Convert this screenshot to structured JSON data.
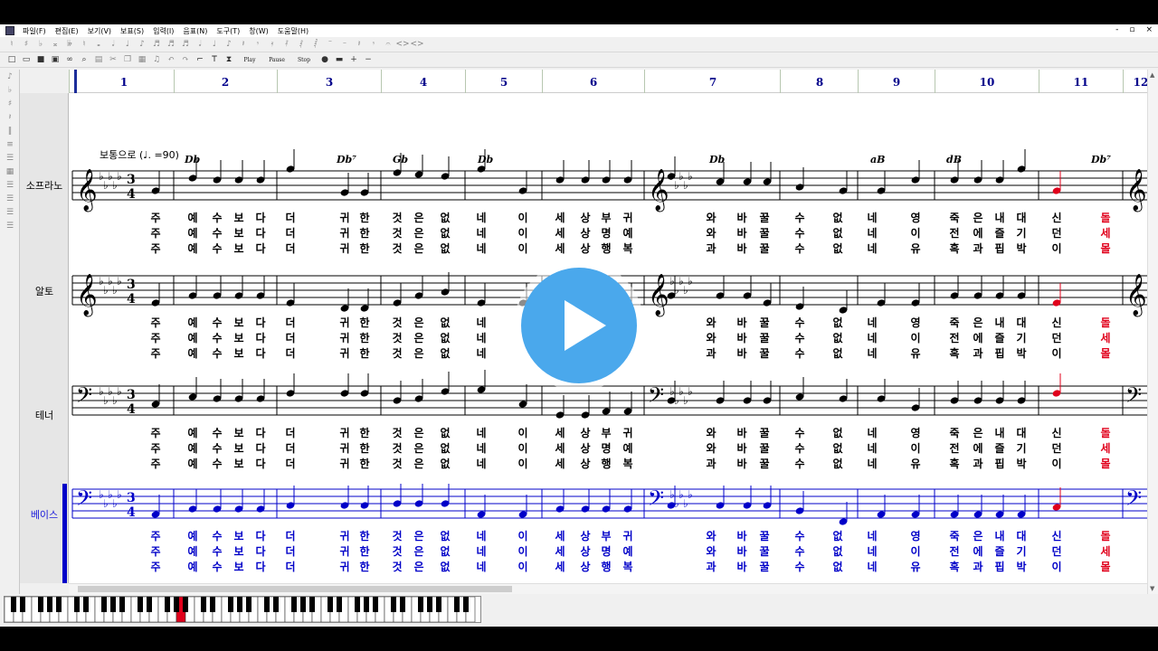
{
  "menu": [
    "파일(F)",
    "편집(E)",
    "보기(V)",
    "보표(S)",
    "입력(I)",
    "음표(N)",
    "도구(T)",
    "창(W)",
    "도움말(H)"
  ],
  "window_controls": [
    "-",
    "▫",
    "×"
  ],
  "toolbar1": [
    "♮",
    "♯",
    "♭",
    "𝄪",
    "𝄫",
    "♮",
    "𝅝",
    "𝅗𝅥",
    "♩",
    "♪",
    "♬",
    "♬",
    "♬",
    "𝅗𝅥",
    "♩",
    "♪",
    "𝄽",
    "𝄾",
    "𝄿",
    "𝅀",
    "𝅁",
    "𝅂",
    "𝄻",
    "𝄼",
    "𝄽",
    "𝄾",
    "𝄐",
    "<>",
    "<>"
  ],
  "toolbar2": {
    "icons": [
      "new-icon",
      "open-icon",
      "save-icon",
      "print-icon",
      "preview-icon",
      "zoom-icon",
      "page-icon",
      "cut-icon",
      "copy-icon",
      "paste-icon",
      "note-icon",
      "undo-icon",
      "redo-icon",
      "tie-icon",
      "text-icon",
      "metronome-icon"
    ],
    "play_label": "Play",
    "pause_label": "Pause",
    "stop_label": "Stop"
  },
  "ruler": {
    "measures": [
      "1",
      "2",
      "3",
      "4",
      "5",
      "6",
      "7",
      "8",
      "9",
      "10",
      "11",
      "12"
    ]
  },
  "score": {
    "tempo": "보통으로 (♩. =90)",
    "chords": [
      "Db",
      "Db⁷",
      "Gb",
      "Db",
      "Db",
      "aB",
      "dB",
      "Db⁷"
    ],
    "staves": [
      {
        "name": "소프라노",
        "clef": "𝄞",
        "active": false
      },
      {
        "name": "알토",
        "clef": "𝄞",
        "active": false
      },
      {
        "name": "테너",
        "clef": "𝄢",
        "active": false
      },
      {
        "name": "베이스",
        "clef": "𝄢",
        "active": true
      }
    ],
    "lyrics_line1": [
      "주",
      "예",
      "수",
      "보",
      "다",
      "더",
      "귀",
      "한",
      "것",
      "은",
      "없",
      "네",
      "이",
      "세",
      "상",
      "부",
      "귀",
      "와",
      "바",
      "꿀",
      "수",
      "없",
      "네",
      "영",
      "죽",
      "은",
      "내",
      "대",
      "신",
      "돌"
    ],
    "lyrics_line2": [
      "주",
      "예",
      "수",
      "보",
      "다",
      "더",
      "귀",
      "한",
      "것",
      "은",
      "없",
      "네",
      "이",
      "세",
      "상",
      "명",
      "예",
      "와",
      "바",
      "꿀",
      "수",
      "없",
      "네",
      "이",
      "전",
      "에",
      "즐",
      "기",
      "던",
      "세"
    ],
    "lyrics_line3": [
      "주",
      "예",
      "수",
      "보",
      "다",
      "더",
      "귀",
      "한",
      "것",
      "은",
      "없",
      "네",
      "이",
      "세",
      "상",
      "행",
      "복",
      "과",
      "바",
      "꿀",
      "수",
      "없",
      "네",
      "유",
      "혹",
      "과",
      "핍",
      "박",
      "이",
      "몰"
    ],
    "alto_lyrics_line1": [
      "주",
      "예",
      "수",
      "보",
      "다",
      "더",
      "귀",
      "한",
      "것",
      "은",
      "없",
      "네",
      "",
      "",
      "",
      "",
      "",
      "와",
      "바",
      "꿀",
      "수",
      "없",
      "네",
      "영",
      "죽",
      "은",
      "내",
      "대",
      "신",
      "돌"
    ],
    "alto_lyrics_line2": [
      "주",
      "예",
      "수",
      "보",
      "다",
      "더",
      "귀",
      "한",
      "것",
      "은",
      "없",
      "네",
      "",
      "",
      "",
      "",
      "",
      "와",
      "바",
      "꿀",
      "수",
      "없",
      "네",
      "이",
      "전",
      "에",
      "즐",
      "기",
      "던",
      "세"
    ],
    "alto_lyrics_line3": [
      "주",
      "예",
      "수",
      "보",
      "다",
      "더",
      "귀",
      "한",
      "것",
      "은",
      "없",
      "네",
      "",
      "",
      "",
      "",
      "",
      "과",
      "바",
      "꿀",
      "수",
      "없",
      "네",
      "유",
      "혹",
      "과",
      "핍",
      "박",
      "이",
      "몰"
    ]
  },
  "colors": {
    "accent": "#0000c8",
    "highlight": "#e0001b",
    "play_button": "#4aa8ec",
    "measure_number": "#00008b"
  }
}
